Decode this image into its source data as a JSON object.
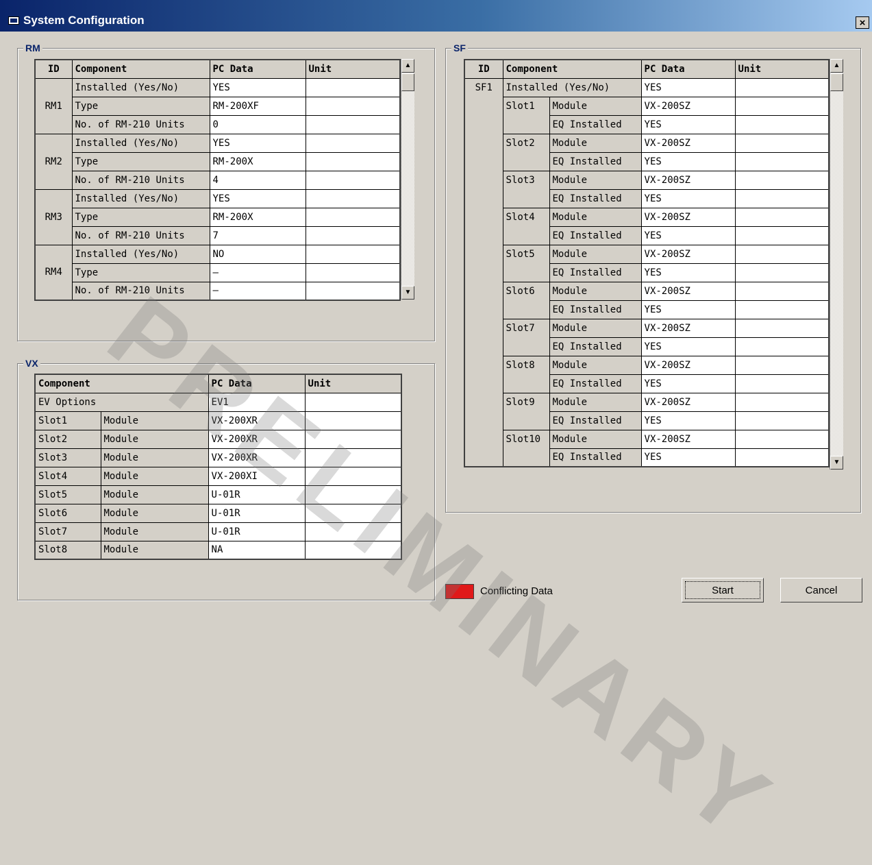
{
  "window": {
    "title": "System Configuration",
    "close_label": "×"
  },
  "rm": {
    "group_label": "RM",
    "headers": [
      "ID",
      "Component",
      "PC Data",
      "Unit"
    ],
    "units": [
      {
        "id": "RM1",
        "rows": [
          {
            "component": "Installed (Yes/No)",
            "pc": "YES",
            "unit": ""
          },
          {
            "component": "Type",
            "pc": "RM-200XF",
            "unit": ""
          },
          {
            "component": "No. of RM-210 Units",
            "pc": "0",
            "unit": ""
          }
        ]
      },
      {
        "id": "RM2",
        "rows": [
          {
            "component": "Installed (Yes/No)",
            "pc": "YES",
            "unit": ""
          },
          {
            "component": "Type",
            "pc": "RM-200X",
            "unit": ""
          },
          {
            "component": "No. of RM-210 Units",
            "pc": "4",
            "unit": ""
          }
        ]
      },
      {
        "id": "RM3",
        "rows": [
          {
            "component": "Installed (Yes/No)",
            "pc": "YES",
            "unit": ""
          },
          {
            "component": "Type",
            "pc": "RM-200X",
            "unit": ""
          },
          {
            "component": "No. of RM-210 Units",
            "pc": "7",
            "unit": ""
          }
        ]
      },
      {
        "id": "RM4",
        "rows": [
          {
            "component": "Installed (Yes/No)",
            "pc": "NO",
            "unit": ""
          },
          {
            "component": "Type",
            "pc": "—",
            "unit": ""
          },
          {
            "component": "No. of RM-210 Units",
            "pc": "—",
            "unit": ""
          }
        ]
      }
    ]
  },
  "vx": {
    "group_label": "VX",
    "headers": [
      "Component",
      "PC Data",
      "Unit"
    ],
    "ev_label": "EV Options",
    "ev_value": "EV1",
    "ev_unit": "",
    "slots": [
      {
        "slot": "Slot1",
        "component": "Module",
        "pc": "VX-200XR",
        "unit": ""
      },
      {
        "slot": "Slot2",
        "component": "Module",
        "pc": "VX-200XR",
        "unit": ""
      },
      {
        "slot": "Slot3",
        "component": "Module",
        "pc": "VX-200XR",
        "unit": ""
      },
      {
        "slot": "Slot4",
        "component": "Module",
        "pc": "VX-200XI",
        "unit": ""
      },
      {
        "slot": "Slot5",
        "component": "Module",
        "pc": "U-01R",
        "unit": ""
      },
      {
        "slot": "Slot6",
        "component": "Module",
        "pc": "U-01R",
        "unit": ""
      },
      {
        "slot": "Slot7",
        "component": "Module",
        "pc": "U-01R",
        "unit": ""
      },
      {
        "slot": "Slot8",
        "component": "Module",
        "pc": "NA",
        "unit": ""
      }
    ]
  },
  "sf": {
    "group_label": "SF",
    "headers": [
      "ID",
      "Component",
      "PC Data",
      "Unit"
    ],
    "id": "SF1",
    "installed_label": "Installed (Yes/No)",
    "installed_value": "YES",
    "installed_unit": "",
    "module_label": "Module",
    "eq_label": "EQ Installed",
    "slots": [
      {
        "slot": "Slot1",
        "module": "VX-200SZ",
        "eq": "YES",
        "module_unit": "",
        "eq_unit": ""
      },
      {
        "slot": "Slot2",
        "module": "VX-200SZ",
        "eq": "YES",
        "module_unit": "",
        "eq_unit": ""
      },
      {
        "slot": "Slot3",
        "module": "VX-200SZ",
        "eq": "YES",
        "module_unit": "",
        "eq_unit": ""
      },
      {
        "slot": "Slot4",
        "module": "VX-200SZ",
        "eq": "YES",
        "module_unit": "",
        "eq_unit": ""
      },
      {
        "slot": "Slot5",
        "module": "VX-200SZ",
        "eq": "YES",
        "module_unit": "",
        "eq_unit": ""
      },
      {
        "slot": "Slot6",
        "module": "VX-200SZ",
        "eq": "YES",
        "module_unit": "",
        "eq_unit": ""
      },
      {
        "slot": "Slot7",
        "module": "VX-200SZ",
        "eq": "YES",
        "module_unit": "",
        "eq_unit": ""
      },
      {
        "slot": "Slot8",
        "module": "VX-200SZ",
        "eq": "YES",
        "module_unit": "",
        "eq_unit": ""
      },
      {
        "slot": "Slot9",
        "module": "VX-200SZ",
        "eq": "YES",
        "module_unit": "",
        "eq_unit": ""
      },
      {
        "slot": "Slot10",
        "module": "VX-200SZ",
        "eq": "YES",
        "module_unit": "",
        "eq_unit": ""
      }
    ]
  },
  "legend": {
    "label": "Conflicting Data",
    "color": "#e01919"
  },
  "buttons": {
    "start": "Start",
    "cancel": "Cancel"
  },
  "scroll": {
    "up_icon": "▲",
    "down_icon": "▼"
  },
  "watermark": "PRELIMINARY"
}
